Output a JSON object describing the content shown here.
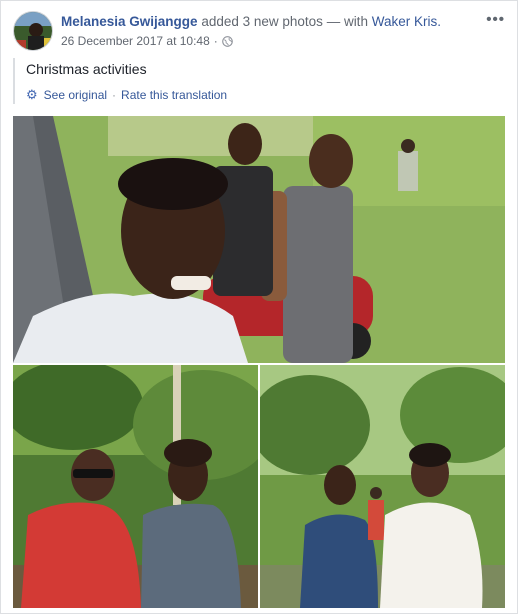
{
  "post": {
    "author": "Melanesia Gwijangge",
    "action": "added 3 new photos",
    "with_text": "— with",
    "tagged": "Waker Kris.",
    "timestamp": "26 December 2017 at 10:48",
    "meta_separator": "·",
    "caption": "Christmas activities",
    "more_label": "•••",
    "translation": {
      "see_original": "See original",
      "separator": "·",
      "rate": "Rate this translation"
    }
  },
  "icons": {
    "avatar": "profile-avatar",
    "privacy": "globe-icon",
    "translate": "gear-icon",
    "menu": "more-options-icon"
  },
  "colors": {
    "link": "#365899",
    "meta": "#616770",
    "text": "#1d2129"
  }
}
